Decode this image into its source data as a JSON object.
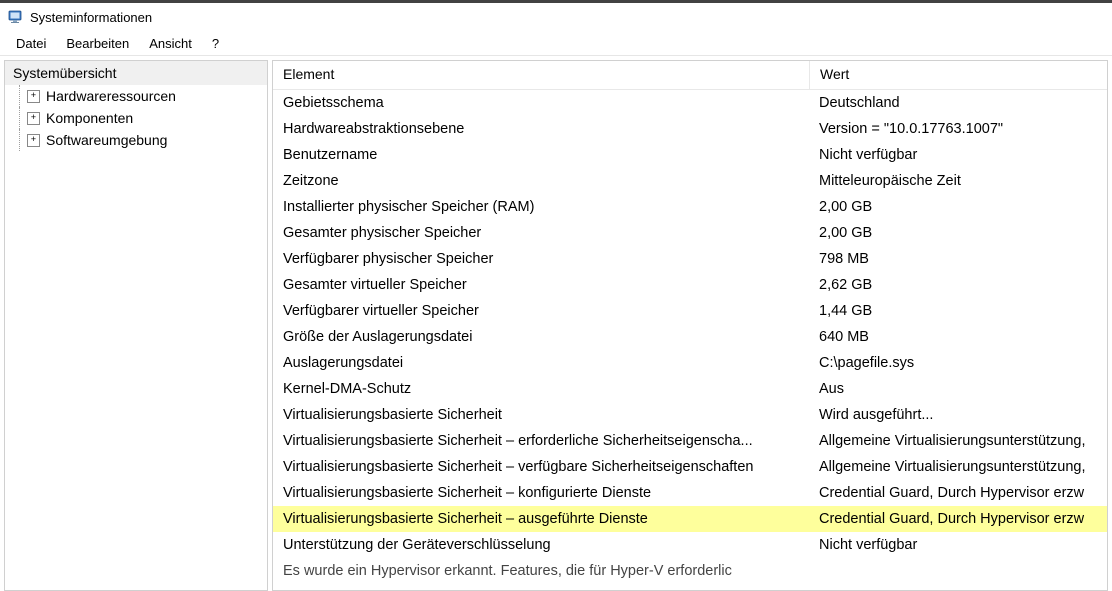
{
  "window": {
    "title": "Systeminformationen"
  },
  "menubar": {
    "file": "Datei",
    "edit": "Bearbeiten",
    "view": "Ansicht",
    "help": "?"
  },
  "tree": {
    "root": "Systemübersicht",
    "items": [
      {
        "label": "Hardwareressourcen"
      },
      {
        "label": "Komponenten"
      },
      {
        "label": "Softwareumgebung"
      }
    ]
  },
  "list": {
    "headers": {
      "element": "Element",
      "wert": "Wert"
    },
    "rows": [
      {
        "element": "Gebietsschema",
        "wert": "Deutschland",
        "highlight": false
      },
      {
        "element": "Hardwareabstraktionsebene",
        "wert": "Version = \"10.0.17763.1007\"",
        "highlight": false
      },
      {
        "element": "Benutzername",
        "wert": "Nicht verfügbar",
        "highlight": false
      },
      {
        "element": "Zeitzone",
        "wert": "Mitteleuropäische Zeit",
        "highlight": false
      },
      {
        "element": "Installierter physischer Speicher (RAM)",
        "wert": "2,00 GB",
        "highlight": false
      },
      {
        "element": "Gesamter physischer Speicher",
        "wert": "2,00 GB",
        "highlight": false
      },
      {
        "element": "Verfügbarer physischer Speicher",
        "wert": "798 MB",
        "highlight": false
      },
      {
        "element": "Gesamter virtueller Speicher",
        "wert": "2,62 GB",
        "highlight": false
      },
      {
        "element": "Verfügbarer virtueller Speicher",
        "wert": "1,44 GB",
        "highlight": false
      },
      {
        "element": "Größe der Auslagerungsdatei",
        "wert": "640 MB",
        "highlight": false
      },
      {
        "element": "Auslagerungsdatei",
        "wert": "C:\\pagefile.sys",
        "highlight": false
      },
      {
        "element": "Kernel-DMA-Schutz",
        "wert": "Aus",
        "highlight": false
      },
      {
        "element": "Virtualisierungsbasierte Sicherheit",
        "wert": "Wird ausgeführt...",
        "highlight": false
      },
      {
        "element": "Virtualisierungsbasierte Sicherheit – erforderliche Sicherheitseigenscha...",
        "wert": "Allgemeine Virtualisierungsunterstützung,",
        "highlight": false
      },
      {
        "element": "Virtualisierungsbasierte Sicherheit – verfügbare Sicherheitseigenschaften",
        "wert": "Allgemeine Virtualisierungsunterstützung,",
        "highlight": false
      },
      {
        "element": "Virtualisierungsbasierte Sicherheit – konfigurierte Dienste",
        "wert": "Credential Guard, Durch Hypervisor erzw",
        "highlight": false
      },
      {
        "element": "Virtualisierungsbasierte Sicherheit – ausgeführte Dienste",
        "wert": "Credential Guard, Durch Hypervisor erzw",
        "highlight": true
      },
      {
        "element": "Unterstützung der Geräteverschlüsselung",
        "wert": "Nicht verfügbar",
        "highlight": false
      },
      {
        "element": "Es wurde ein Hypervisor erkannt. Features, die für Hyper-V erforderlic",
        "wert": "",
        "highlight": false,
        "cutoff": true
      }
    ]
  }
}
